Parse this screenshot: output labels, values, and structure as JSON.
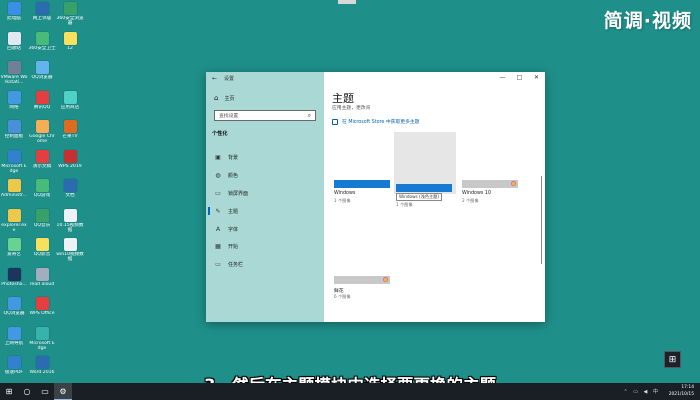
{
  "desktop_icons": [
    {
      "id": "pc",
      "label": "此电脑",
      "color": "#3a8ee6",
      "col": 0,
      "row": 0
    },
    {
      "id": "network",
      "label": "网上邻居",
      "color": "#2b6cb0",
      "col": 1,
      "row": 0
    },
    {
      "id": "360-browser",
      "label": "360安全浏览器",
      "color": "#38a169",
      "col": 2,
      "row": 0
    },
    {
      "id": "recycle",
      "label": "回收站",
      "color": "#e2e8f0",
      "col": 0,
      "row": 1
    },
    {
      "id": "360-safe",
      "label": "360安全卫士",
      "color": "#48bb78",
      "col": 1,
      "row": 1
    },
    {
      "id": "folder-12",
      "label": "12",
      "color": "#f6e05e",
      "col": 2,
      "row": 1
    },
    {
      "id": "vmware",
      "label": "VMware Workstati...",
      "color": "#718096",
      "col": 0,
      "row": 2
    },
    {
      "id": "qq-browser",
      "label": "QQ浏览器",
      "color": "#63b3ed",
      "col": 1,
      "row": 2
    },
    {
      "id": "network2",
      "label": "网络",
      "color": "#4299e1",
      "col": 0,
      "row": 3
    },
    {
      "id": "tencent-qq",
      "label": "腾讯QQ",
      "color": "#e53e3e",
      "col": 1,
      "row": 3
    },
    {
      "id": "store",
      "label": "应用商店",
      "color": "#4fd1c5",
      "col": 2,
      "row": 3
    },
    {
      "id": "control",
      "label": "控制面板",
      "color": "#4a90d9",
      "col": 0,
      "row": 4
    },
    {
      "id": "chrome",
      "label": "Google Chrome",
      "color": "#f6ad55",
      "col": 1,
      "row": 4
    },
    {
      "id": "mango",
      "label": "芒果TV",
      "color": "#dd6b20",
      "col": 2,
      "row": 4
    },
    {
      "id": "edge",
      "label": "Microsoft Edge",
      "color": "#3182ce",
      "col": 0,
      "row": 5
    },
    {
      "id": "ppt",
      "label": "演示文稿",
      "color": "#e53e3e",
      "col": 1,
      "row": 5
    },
    {
      "id": "wps",
      "label": "WPS 2019",
      "color": "#c53030",
      "col": 2,
      "row": 5
    },
    {
      "id": "admin",
      "label": "Administr...",
      "color": "#ecc94b",
      "col": 0,
      "row": 6
    },
    {
      "id": "qq-game",
      "label": "QQ游戏",
      "color": "#48bb78",
      "col": 1,
      "row": 6
    },
    {
      "id": "word-doc",
      "label": "文档",
      "color": "#2b6cb0",
      "col": 2,
      "row": 6
    },
    {
      "id": "explorer",
      "label": "explorer.exe",
      "color": "#ecc94b",
      "col": 0,
      "row": 7
    },
    {
      "id": "qq-music",
      "label": "QQ音乐",
      "color": "#38a169",
      "col": 1,
      "row": 7
    },
    {
      "id": "txt-file",
      "label": "10.15视频数据",
      "color": "#edf2f7",
      "col": 2,
      "row": 7
    },
    {
      "id": "iqiyi",
      "label": "爱奇艺",
      "color": "#68d391",
      "col": 0,
      "row": 8
    },
    {
      "id": "qq-tv",
      "label": "QQ影音",
      "color": "#f6e05e",
      "col": 1,
      "row": 8
    },
    {
      "id": "win10-file",
      "label": "win10视频数据",
      "color": "#edf2f7",
      "col": 2,
      "row": 8
    },
    {
      "id": "photoshop",
      "label": "Photosho...",
      "color": "#1a365d",
      "col": 0,
      "row": 9
    },
    {
      "id": "read-aloud",
      "label": "read aloud",
      "color": "#a0aec0",
      "col": 1,
      "row": 9
    },
    {
      "id": "qq-browser2",
      "label": "QQ浏览器",
      "color": "#4299e1",
      "col": 0,
      "row": 10
    },
    {
      "id": "wps-office",
      "label": "WPS Office",
      "color": "#e53e3e",
      "col": 1,
      "row": 10
    },
    {
      "id": "shortcut",
      "label": "上网导航",
      "color": "#4299e1",
      "col": 0,
      "row": 11
    },
    {
      "id": "ms-edge2",
      "label": "Microsoft Edge",
      "color": "#38b2ac",
      "col": 1,
      "row": 11
    },
    {
      "id": "pdf",
      "label": "极速PDF",
      "color": "#3182ce",
      "col": 0,
      "row": 12
    },
    {
      "id": "word-2016",
      "label": "Word 2016",
      "color": "#2b6cb0",
      "col": 1,
      "row": 12
    }
  ],
  "watermark": "简调·视频",
  "window": {
    "title": "设置",
    "home": "主页",
    "search_placeholder": "查找设置",
    "section": "个性化",
    "nav": [
      {
        "id": "background",
        "icon": "▣",
        "label": "背景",
        "active": false
      },
      {
        "id": "colors",
        "icon": "◍",
        "label": "颜色",
        "active": false
      },
      {
        "id": "lockscreen",
        "icon": "▭",
        "label": "锁屏界面",
        "active": false
      },
      {
        "id": "themes",
        "icon": "✎",
        "label": "主题",
        "active": true
      },
      {
        "id": "fonts",
        "icon": "A",
        "label": "字体",
        "active": false
      },
      {
        "id": "start",
        "icon": "▦",
        "label": "开始",
        "active": false
      },
      {
        "id": "taskbar",
        "icon": "▭",
        "label": "任务栏",
        "active": false
      }
    ],
    "page_title": "主题",
    "page_subtitle": "应用主题，更改背",
    "store_link": "在 Microsoft Store 中获取更多主题",
    "themes": [
      {
        "id": "windows",
        "name": "Windows",
        "count": "1 个图像",
        "bar": "#1679d3",
        "dot": false,
        "selected": false
      },
      {
        "id": "windows-light",
        "name": "Windows",
        "count": "1 个图像",
        "bar": "#1679d3",
        "dot": false,
        "selected": true,
        "tooltip": "Windows (浅色主题)"
      },
      {
        "id": "windows-10",
        "name": "Windows 10",
        "count": "2 个图像",
        "bar": "#c8c8c8",
        "dot": true,
        "selected": false
      },
      {
        "id": "flowers",
        "name": "鲜花",
        "count": "6 个图像",
        "bar": "#c8c8c8",
        "dot": true,
        "selected": false
      }
    ]
  },
  "subtitle": "3、然后在主题模块中选择要更换的主题",
  "taskbar": {
    "clock_time": "17:14",
    "clock_date": "2021/10/15"
  }
}
